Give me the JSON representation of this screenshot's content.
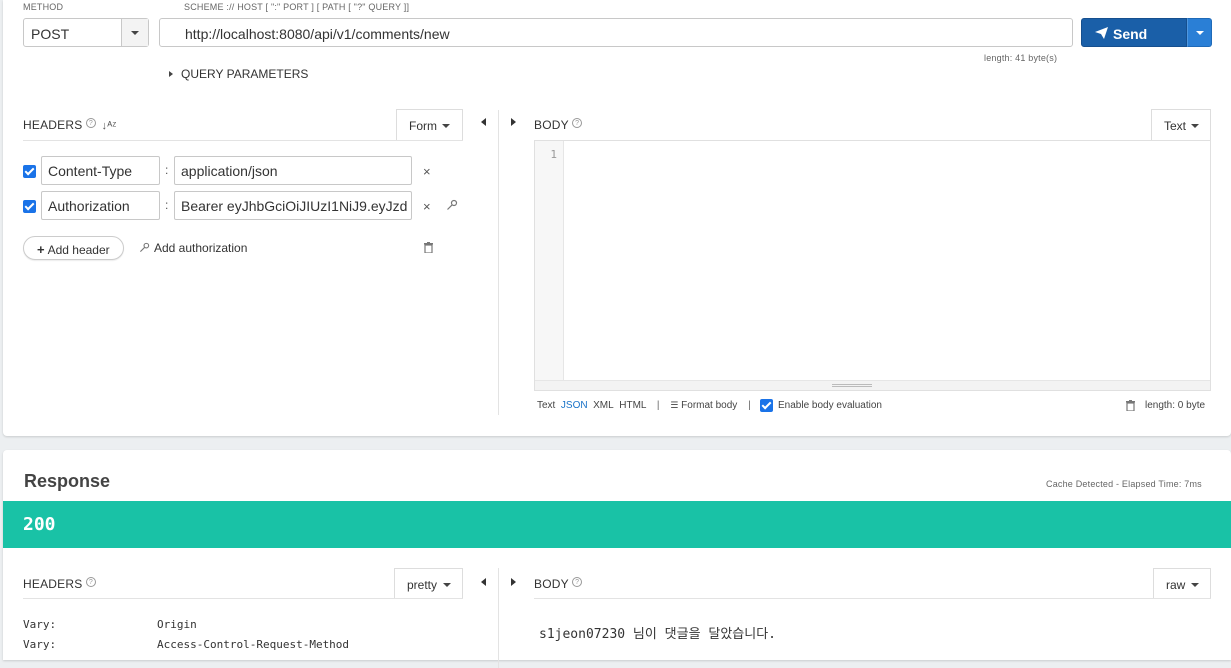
{
  "request": {
    "method_label": "METHOD",
    "method_value": "POST",
    "url_label": "SCHEME :// HOST [ \":\" PORT ] [ PATH [ \"?\" QUERY ]]",
    "url_value": "http://localhost:8080/api/v1/comments/new",
    "length_text": "length: 41 byte(s)",
    "send_label": "Send",
    "query_params_label": "QUERY PARAMETERS",
    "headers_title": "HEADERS",
    "headers_mode": "Form",
    "headers": [
      {
        "name": "Content-Type",
        "value": "application/json",
        "checked": true
      },
      {
        "name": "Authorization",
        "value": "Bearer eyJhbGciOiJIUzI1NiJ9.eyJzd",
        "checked": true
      }
    ],
    "add_header_label": "Add header",
    "add_authorization_label": "Add authorization",
    "body_title": "BODY",
    "body_mode": "Text",
    "line_number": "1",
    "body_formats": [
      "Text",
      "JSON",
      "XML",
      "HTML"
    ],
    "format_body_label": "Format body",
    "enable_body_eval_label": "Enable body evaluation",
    "body_length_text": "length: 0 byte"
  },
  "response": {
    "title": "Response",
    "cache_text": "Cache Detected - Elapsed Time: 7ms",
    "status_code": "200",
    "headers_title": "HEADERS",
    "headers_mode": "pretty",
    "body_title": "BODY",
    "body_mode": "raw",
    "headers": [
      {
        "name": "Vary:",
        "value": "Origin"
      },
      {
        "name": "Vary:",
        "value": "Access-Control-Request-Method"
      }
    ],
    "body_text": "s1jeon07230 님이 댓글을 달았습니다."
  },
  "colors": {
    "send": "#1a5fa8",
    "status_ok": "#19c2a6",
    "checkbox": "#1a73e8",
    "json_active": "#1a73c8"
  }
}
